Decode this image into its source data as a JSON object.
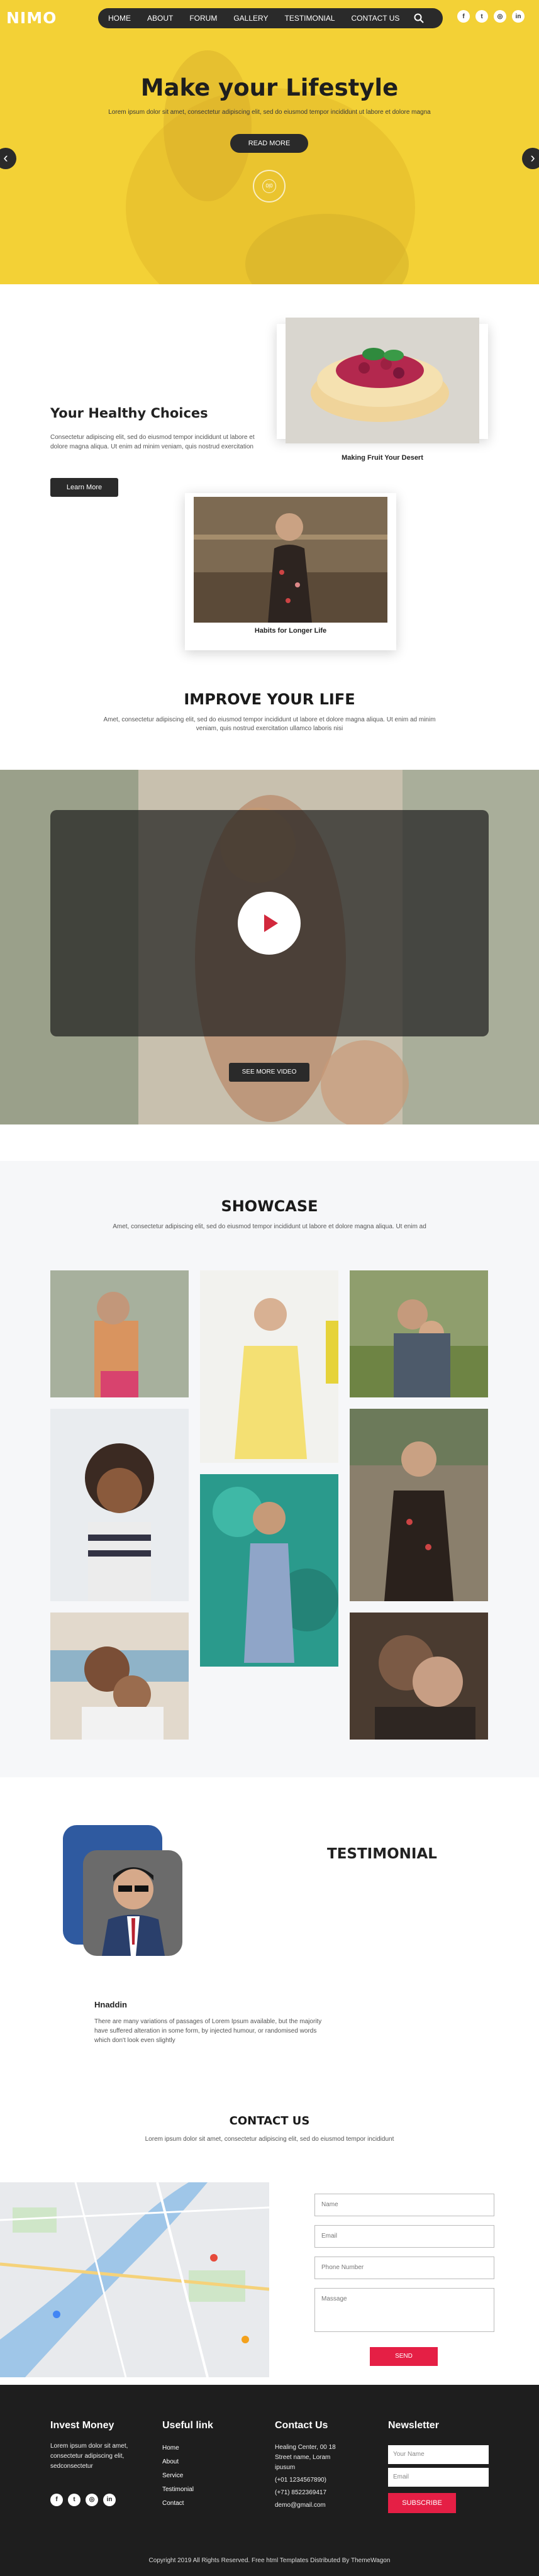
{
  "header": {
    "brand": "NIMO",
    "nav": [
      "HOME",
      "ABOUT",
      "FORUM",
      "GALLERY",
      "TESTIMONIAL",
      "CONTACT US"
    ],
    "search_icon": "search-icon",
    "social_icons": [
      "facebook-icon",
      "twitter-icon",
      "instagram-icon",
      "linkedin-icon"
    ]
  },
  "hero": {
    "title": "Make your Lifestyle",
    "subtitle": "Lorem ipsum dolor sit amet, consectetur adipiscing elit, sed do eiusmod tempor incididunt ut labore et dolore magna",
    "button": "READ MORE",
    "indicator": "0|0",
    "prev_icon": "chevron-left-icon",
    "next_icon": "chevron-right-icon",
    "accent": "#f3d136"
  },
  "healthy": {
    "title": "Your Healthy Choices",
    "text": "Consectetur adipiscing elit, sed do eiusmod tempor incididunt ut labore et dolore magna aliqua. Ut enim ad minim veniam, quis nostrud exercitation",
    "button": "Learn More",
    "card1_caption": "Making Fruit Your Desert",
    "card2_caption": "Habits for Longer Life"
  },
  "improve": {
    "title": "IMPROVE YOUR LIFE",
    "subtitle": "Amet, consectetur adipiscing elit, sed do eiusmod tempor incididunt ut labore et dolore magna aliqua. Ut enim ad minim veniam, quis nostrud exercitation ullamco laboris nisi",
    "video_button": "SEE MORE VIDEO"
  },
  "showcase": {
    "title": "SHOWCASE",
    "subtitle": "Amet, consectetur adipiscing elit, sed do eiusmod tempor incididunt ut labore et dolore magna aliqua. Ut enim ad"
  },
  "testimonial": {
    "title": "TESTIMONIAL",
    "name": "Hnaddin",
    "text": "There are many variations of passages of Lorem Ipsum available, but the majority have suffered alteration in some form, by injected humour, or randomised words which don't look even slightly"
  },
  "contact": {
    "title": "CONTACT US",
    "subtitle": "Lorem ipsum dolor sit amet, consectetur adipiscing elit, sed do eiusmod tempor incididunt",
    "placeholders": {
      "name": "Name",
      "email": "Email",
      "phone": "Phone Number",
      "message": "Massage"
    },
    "send": "SEND"
  },
  "footer": {
    "col1_title": "Invest Money",
    "col1_text": "Lorem ipsum dolor sit amet, consectetur adipiscing elit, sedconsectetur",
    "col2_title": "Useful link",
    "links": [
      "Home",
      "About",
      "Service",
      "Testimonial",
      "Contact"
    ],
    "col3_title": "Contact Us",
    "address": "Healing Center, 00 18 Street name, Loram ipusum",
    "phone1": "(+01 1234567890)",
    "phone2": "(+71) 8522369417",
    "email": "demo@gmail.com",
    "col4_title": "Newsletter",
    "your_name": "Your Name",
    "email_ph": "Email",
    "subscribe": "SUBSCRIBE",
    "copyright": "Copyright 2019 All Rights Reserved. Free html Templates Distributed By ThemeWagon",
    "brand_red": "#e51f45"
  }
}
